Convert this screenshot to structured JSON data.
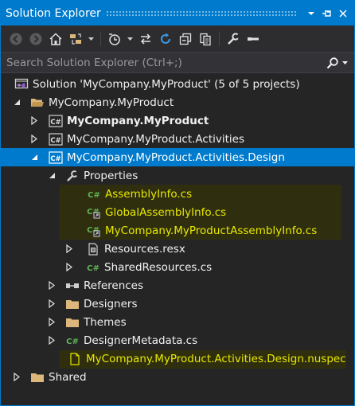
{
  "window": {
    "title": "Solution Explorer",
    "controls": {
      "dropdown": "▾",
      "pin": "⊣",
      "close": "✕"
    }
  },
  "toolbar": {
    "buttons": [
      "back-icon",
      "forward-icon",
      "home-icon",
      "switch-views-icon",
      "pending-changes-filter-icon",
      "sync-icon",
      "refresh-icon",
      "collapse-all-icon",
      "show-all-files-icon",
      "properties-icon",
      "preview-icon"
    ]
  },
  "search": {
    "placeholder": "Search Solution Explorer (Ctrl+;)"
  },
  "tree": {
    "solution": "Solution 'MyCompany.MyProduct' (5 of 5 projects)",
    "folder_main": "MyCompany.MyProduct",
    "proj_main": "MyCompany.MyProduct",
    "proj_activities": "MyCompany.MyProduct.Activities",
    "proj_design": "MyCompany.MyProduct.Activities.Design",
    "properties": "Properties",
    "assemblyinfo": "AssemblyInfo.cs",
    "globalassemblyinfo": "GlobalAssemblyInfo.cs",
    "productassemblyinfo": "MyCompany.MyProductAssemblyInfo.cs",
    "resources": "Resources.resx",
    "sharedresources": "SharedResources.cs",
    "references": "References",
    "designers": "Designers",
    "themes": "Themes",
    "designermetadata": "DesignerMetadata.cs",
    "nuspec": "MyCompany.MyProduct.Activities.Design.nuspec",
    "shared": "Shared",
    "cs_badge": "C#"
  },
  "colors": {
    "accent": "#007acc",
    "background": "#252526",
    "highlight_bg": "#2f2f10",
    "highlight_text": "#e8e800",
    "folder": "#dcb67a",
    "csharp_green": "#6a9955"
  }
}
